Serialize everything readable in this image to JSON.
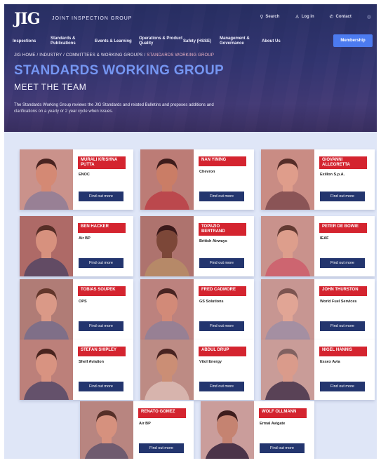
{
  "header": {
    "logo": "JIG",
    "logo_subtitle": "JOINT INSPECTION GROUP",
    "utility": [
      {
        "icon": "search-icon",
        "glyph": "⚲",
        "label": "Search"
      },
      {
        "icon": "user-icon",
        "glyph": "♙",
        "label": "Log in"
      },
      {
        "icon": "phone-icon",
        "glyph": "✆",
        "label": "Contact"
      },
      {
        "icon": "globe-icon",
        "glyph": "◍",
        "label": ""
      }
    ],
    "nav": [
      "Inspections",
      "Standards & Publications",
      "Events & Learning",
      "Operations & Product Quality",
      "Safety (HSSE)",
      "Management & Governance",
      "About Us"
    ],
    "member_button": "Membership"
  },
  "hero": {
    "breadcrumb": [
      "JIG HOME",
      "INDUSTRY",
      "COMMITTEES & WORKING GROUPS"
    ],
    "breadcrumb_current": "STANDARDS WORKING GROUP",
    "breadcrumb_separator": " / ",
    "title": "STANDARDS WORKING GROUP",
    "subtitle": "MEET THE TEAM",
    "intro": "The Standards Working Group reviews the JIG Standards and related Bulletins and proposes additions and clarifications on a yearly or 2 year cycle when issues."
  },
  "team": [
    {
      "name": "MURALI KRISHNA PUTTA",
      "company": "ENOC",
      "button": "Find out more"
    },
    {
      "name": "NAN YINING",
      "company": "Chevron",
      "button": "Find out more"
    },
    {
      "name": "GIOVANNI ALLEGRETTA",
      "company": "Exillon S.p.A.",
      "button": "Find out more"
    },
    {
      "name": "BEN HACKER",
      "company": "Air BP",
      "button": "Find out more"
    },
    {
      "name": "TOPAZIO BERTRAND",
      "company": "British Airways",
      "button": "Find out more"
    },
    {
      "name": "PETER DE BOWIE",
      "company": "IEAF",
      "button": "Find out more"
    },
    {
      "name": "TOBIAS SOUPEK",
      "company": "OPS",
      "button": "Find out more"
    },
    {
      "name": "FRED CADMORE",
      "company": "GS Solutions",
      "button": "Find out more"
    },
    {
      "name": "JOHN THURSTON",
      "company": "World Fuel Services",
      "button": "Find out more"
    },
    {
      "name": "STEFAN SHIPLEY",
      "company": "Shell Aviation",
      "button": "Find out more"
    },
    {
      "name": "ABDUL DRUP",
      "company": "Vitol Energy",
      "button": "Find out more"
    },
    {
      "name": "NIGEL HANNIS",
      "company": "Essex Avia",
      "button": "Find out more"
    },
    {
      "name": "RENATO GOMEZ",
      "company": "Air BP",
      "button": "Find out more"
    },
    {
      "name": "WOLF OLLMANN",
      "company": "Ermal Avigate",
      "button": "Find out more"
    }
  ],
  "colors": {
    "accent_red": "#d4242f",
    "navy": "#23356e",
    "hero_blue_title": "#7596f2",
    "member_button": "#4c7bf0",
    "background": "#dfe6f7"
  }
}
